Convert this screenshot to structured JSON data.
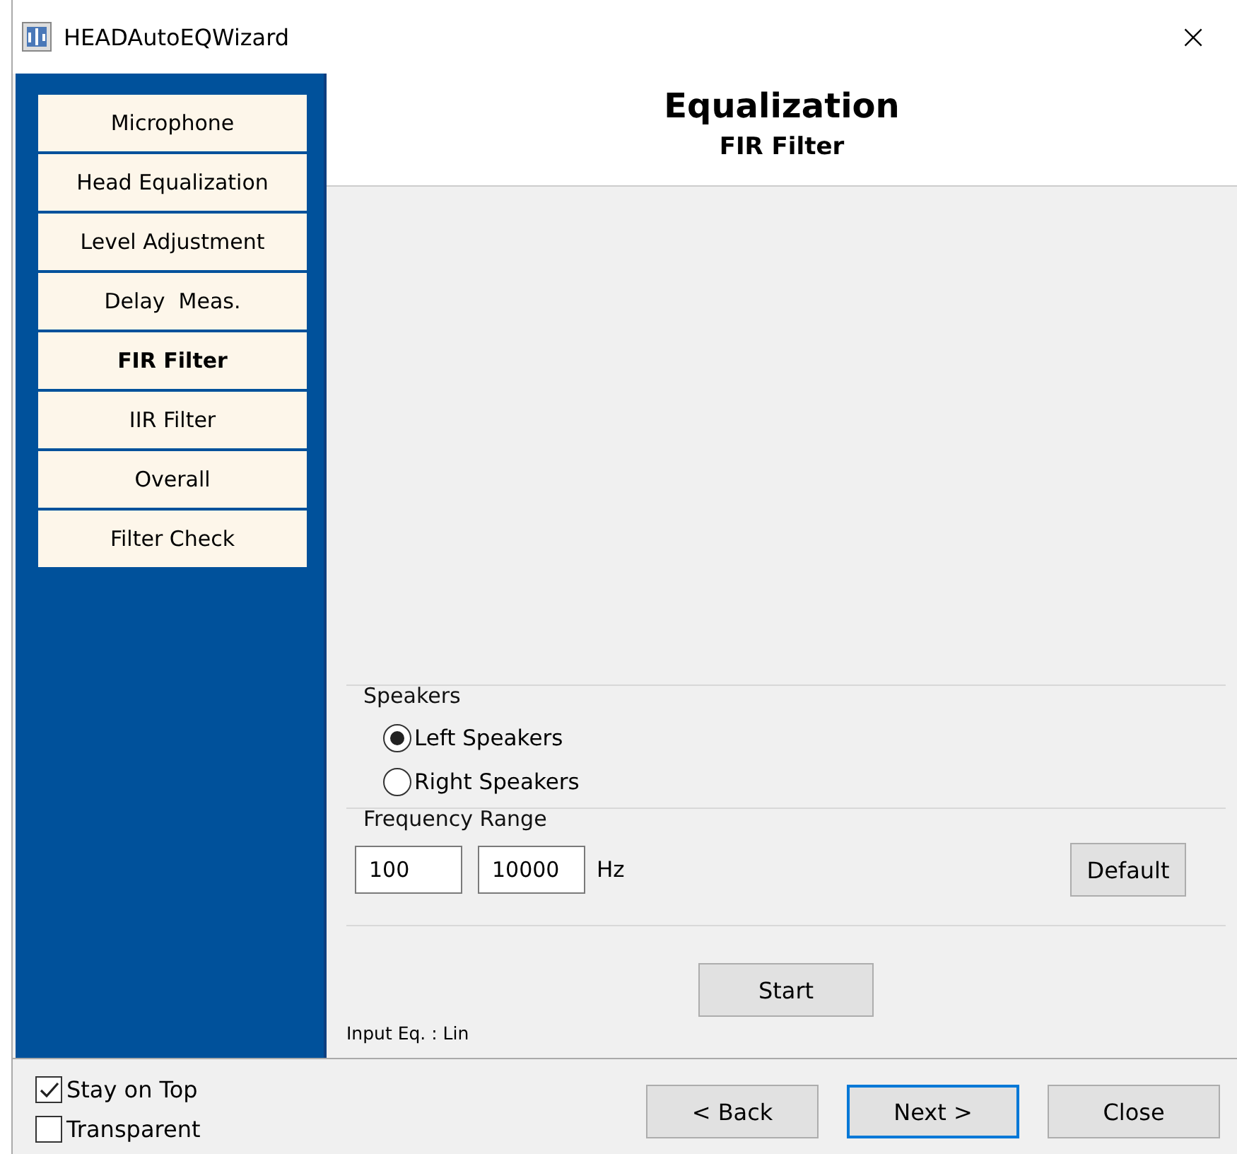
{
  "window": {
    "title": "HEADAutoEQWizard",
    "close": "×"
  },
  "steps": [
    {
      "label": "Microphone",
      "selected": false
    },
    {
      "label": "Head Equalization",
      "selected": false
    },
    {
      "label": "Level Adjustment",
      "selected": false
    },
    {
      "label": "Delay  Meas.",
      "selected": false
    },
    {
      "label": "FIR Filter",
      "selected": true
    },
    {
      "label": "IIR Filter",
      "selected": false
    },
    {
      "label": "Overall",
      "selected": false
    },
    {
      "label": "Filter Check",
      "selected": false
    }
  ],
  "header": {
    "title": "Equalization",
    "subtitle": "FIR Filter"
  },
  "speakers": {
    "legend": "Speakers",
    "options": [
      {
        "label": "Left Speakers",
        "selected": true
      },
      {
        "label": "Right Speakers",
        "selected": false
      }
    ]
  },
  "frequency_range": {
    "legend": "Frequency Range",
    "from": "100",
    "to": "10000",
    "unit": "Hz",
    "default_button": "Default"
  },
  "start_button": "Start",
  "status": "Input Eq. : Lin",
  "options": [
    {
      "label": "Stay on Top",
      "checked": true
    },
    {
      "label": "Transparent",
      "checked": false
    }
  ],
  "buttons": [
    {
      "label": "< Back",
      "focused": false
    },
    {
      "label": "Next >",
      "focused": true
    },
    {
      "label": "Close",
      "focused": false
    }
  ]
}
